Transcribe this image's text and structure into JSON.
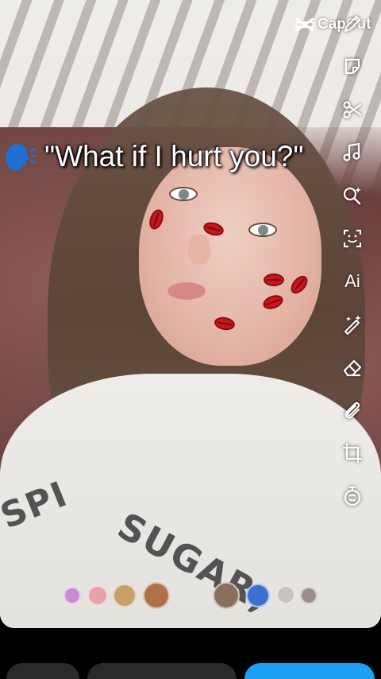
{
  "caption": {
    "text": "\"What if I hurt you?\"",
    "icon": "speaking-head-icon"
  },
  "watermark": {
    "brand": "CapCut",
    "icon": "capcut-logo-icon"
  },
  "toolbar": {
    "items": [
      {
        "icon": "pencil-icon"
      },
      {
        "icon": "sticker-icon"
      },
      {
        "icon": "scissors-icon"
      },
      {
        "icon": "music-note-icon"
      },
      {
        "icon": "search-sparkle-icon"
      },
      {
        "icon": "scan-face-icon"
      },
      {
        "icon": "ai-text-icon",
        "label": "Ai"
      },
      {
        "icon": "magic-wand-icon"
      },
      {
        "icon": "eraser-icon"
      },
      {
        "icon": "paperclip-icon"
      },
      {
        "icon": "crop-icon"
      },
      {
        "icon": "timer-icon"
      }
    ]
  },
  "shirt_text": {
    "line1": "SPI",
    "line2": "SUGAR,"
  },
  "effects": [
    {
      "icon": "effect-lens-icon",
      "color": "#c98bd3"
    },
    {
      "icon": "effect-lens-icon",
      "color": "#e6a3a8"
    },
    {
      "icon": "effect-lens-icon",
      "color": "#c7a06a"
    },
    {
      "icon": "effect-lens-icon",
      "color": "#b0704a"
    },
    {
      "icon": "effect-lens-icon",
      "color": "#8a6f5e"
    },
    {
      "icon": "effect-lens-icon",
      "color": "#3c6fd0"
    },
    {
      "icon": "effect-lens-icon",
      "color": "#c9c4c0"
    },
    {
      "icon": "effect-lens-icon",
      "color": "#9c8f8a"
    }
  ],
  "bottom_bar": {
    "accent": "#1da1f2"
  }
}
